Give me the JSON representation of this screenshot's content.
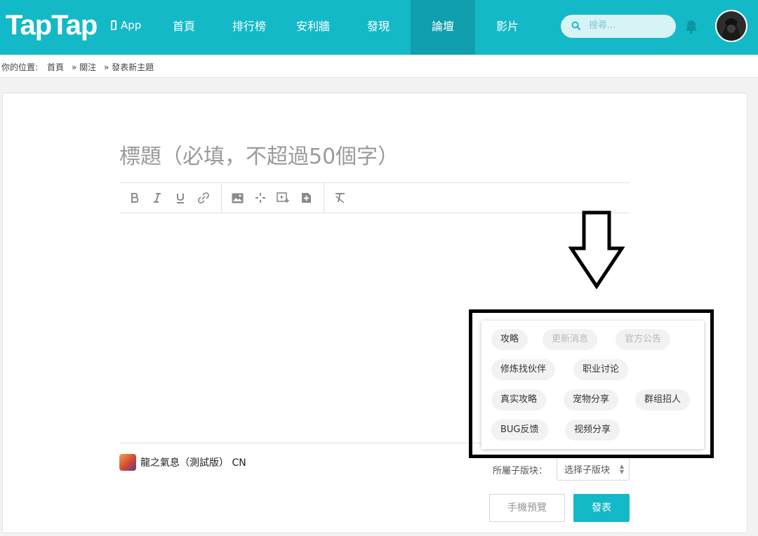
{
  "header": {
    "logo": "TapTap",
    "app_link": "App",
    "nav": [
      "首頁",
      "排行榜",
      "安利牆",
      "發現",
      "論壇",
      "影片"
    ],
    "active_nav": "論壇",
    "search_placeholder": "搜尋...",
    "brand_color": "#14b9c8"
  },
  "breadcrumb": {
    "prefix": "你的位置:",
    "items": [
      "首頁",
      "» 關注",
      "» 發表新主題"
    ]
  },
  "editor": {
    "title_placeholder": "標題（必填，不超過50個字）",
    "toolbar_icons": [
      "bold-icon",
      "italic-icon",
      "underline-icon",
      "link-icon",
      "image-icon",
      "move-icon",
      "video-icon",
      "add-file-icon",
      "clear-format-icon"
    ]
  },
  "footer": {
    "game_name": "龍之氣息（測試版） CN",
    "sub_section_label": "所屬子版块：",
    "sub_section_placeholder": "选择子版块",
    "preview_button": "手機預覽",
    "post_button": "發表"
  },
  "dropdown": {
    "tags": [
      {
        "label": "攻略",
        "disabled": false
      },
      {
        "label": "更新消息",
        "disabled": true
      },
      {
        "label": "官方公告",
        "disabled": true
      },
      {
        "label": "修炼找伙伴",
        "disabled": false
      },
      {
        "label": "职业讨论",
        "disabled": false
      },
      {
        "label": "真实攻略",
        "disabled": false
      },
      {
        "label": "宠物分享",
        "disabled": false
      },
      {
        "label": "群组招人",
        "disabled": false
      },
      {
        "label": "BUG反馈",
        "disabled": false
      },
      {
        "label": "视频分享",
        "disabled": false
      }
    ]
  }
}
